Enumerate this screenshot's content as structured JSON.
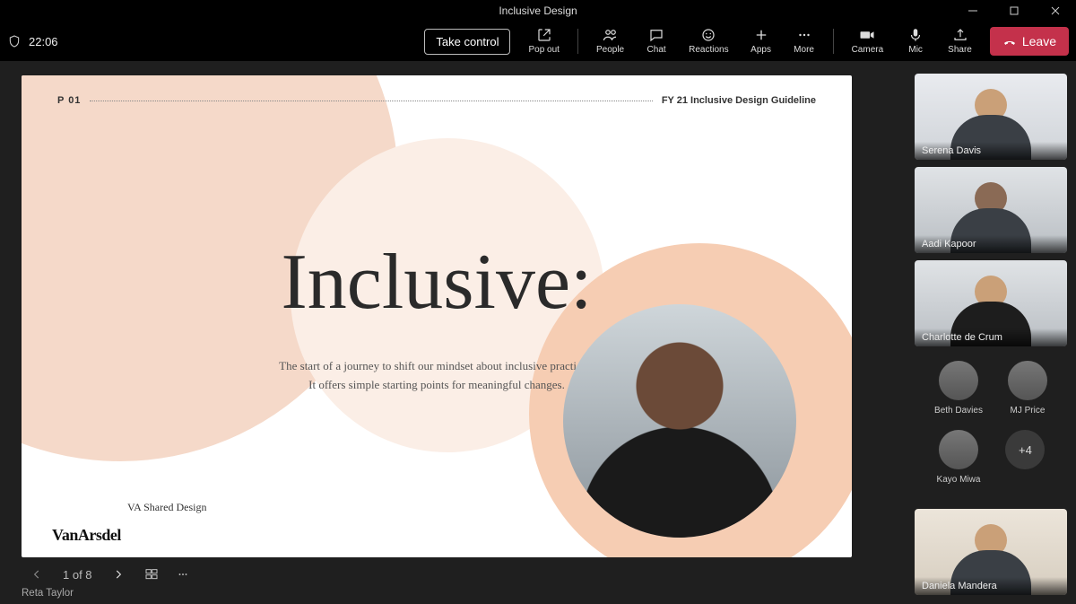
{
  "window": {
    "title": "Inclusive Design"
  },
  "meeting": {
    "duration": "22:06",
    "take_control": "Take control",
    "leave": "Leave"
  },
  "toolbar": {
    "popout": "Pop out",
    "people": "People",
    "chat": "Chat",
    "reactions": "Reactions",
    "apps": "Apps",
    "more": "More",
    "camera": "Camera",
    "mic": "Mic",
    "share": "Share"
  },
  "slide": {
    "page_marker": "P 01",
    "header_right": "FY 21 Inclusive Design Guideline",
    "title": "Inclusive:",
    "subtitle1": "The start of a journey to shift our mindset about inclusive practices.",
    "subtitle2": "It offers simple starting points for meaningful changes.",
    "shared_label": "VA Shared Design",
    "logo": "VanArsdel"
  },
  "footer": {
    "page": "1 of 8",
    "presenter": "Reta Taylor"
  },
  "roster": {
    "tiles": [
      {
        "name": "Serena Davis"
      },
      {
        "name": "Aadi Kapoor"
      },
      {
        "name": "Charlotte de Crum"
      }
    ],
    "circles": [
      {
        "name": "Beth Davies"
      },
      {
        "name": "MJ Price"
      },
      {
        "name": "Kayo Miwa"
      }
    ],
    "overflow": "+4",
    "self": {
      "name": "Daniela Mandera"
    }
  }
}
